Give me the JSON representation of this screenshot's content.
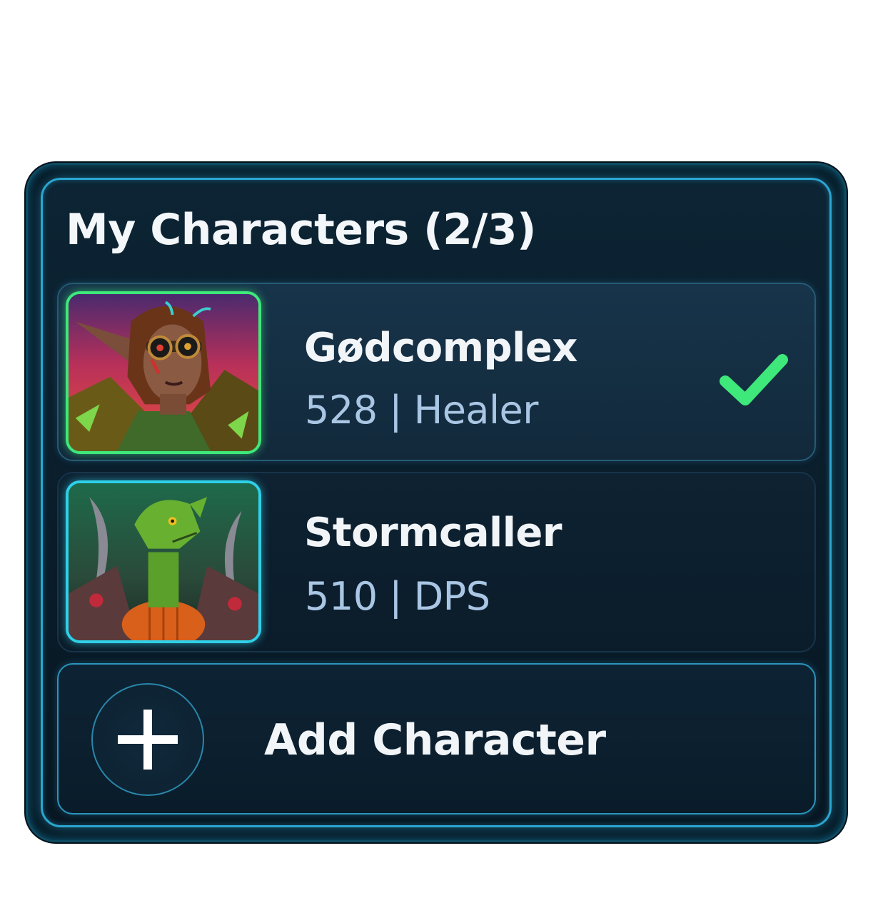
{
  "panel": {
    "title": "My Characters (2/3)"
  },
  "characters": [
    {
      "name": "Gødcomplex",
      "meta": "528 | Healer",
      "selected": true,
      "portrait_icon": "elf-healer-portrait",
      "border_color": "#3ee87a"
    },
    {
      "name": "Stormcaller",
      "meta": "510 | DPS",
      "selected": false,
      "portrait_icon": "lizard-warrior-portrait",
      "border_color": "#2fd0e8"
    }
  ],
  "add_character": {
    "label": "Add Character",
    "icon": "plus-icon"
  },
  "colors": {
    "accent": "#2aa6d0",
    "selected_check": "#3ee87a",
    "meta_text": "#a9c6e4",
    "panel_bg": "#0a1d2b"
  }
}
